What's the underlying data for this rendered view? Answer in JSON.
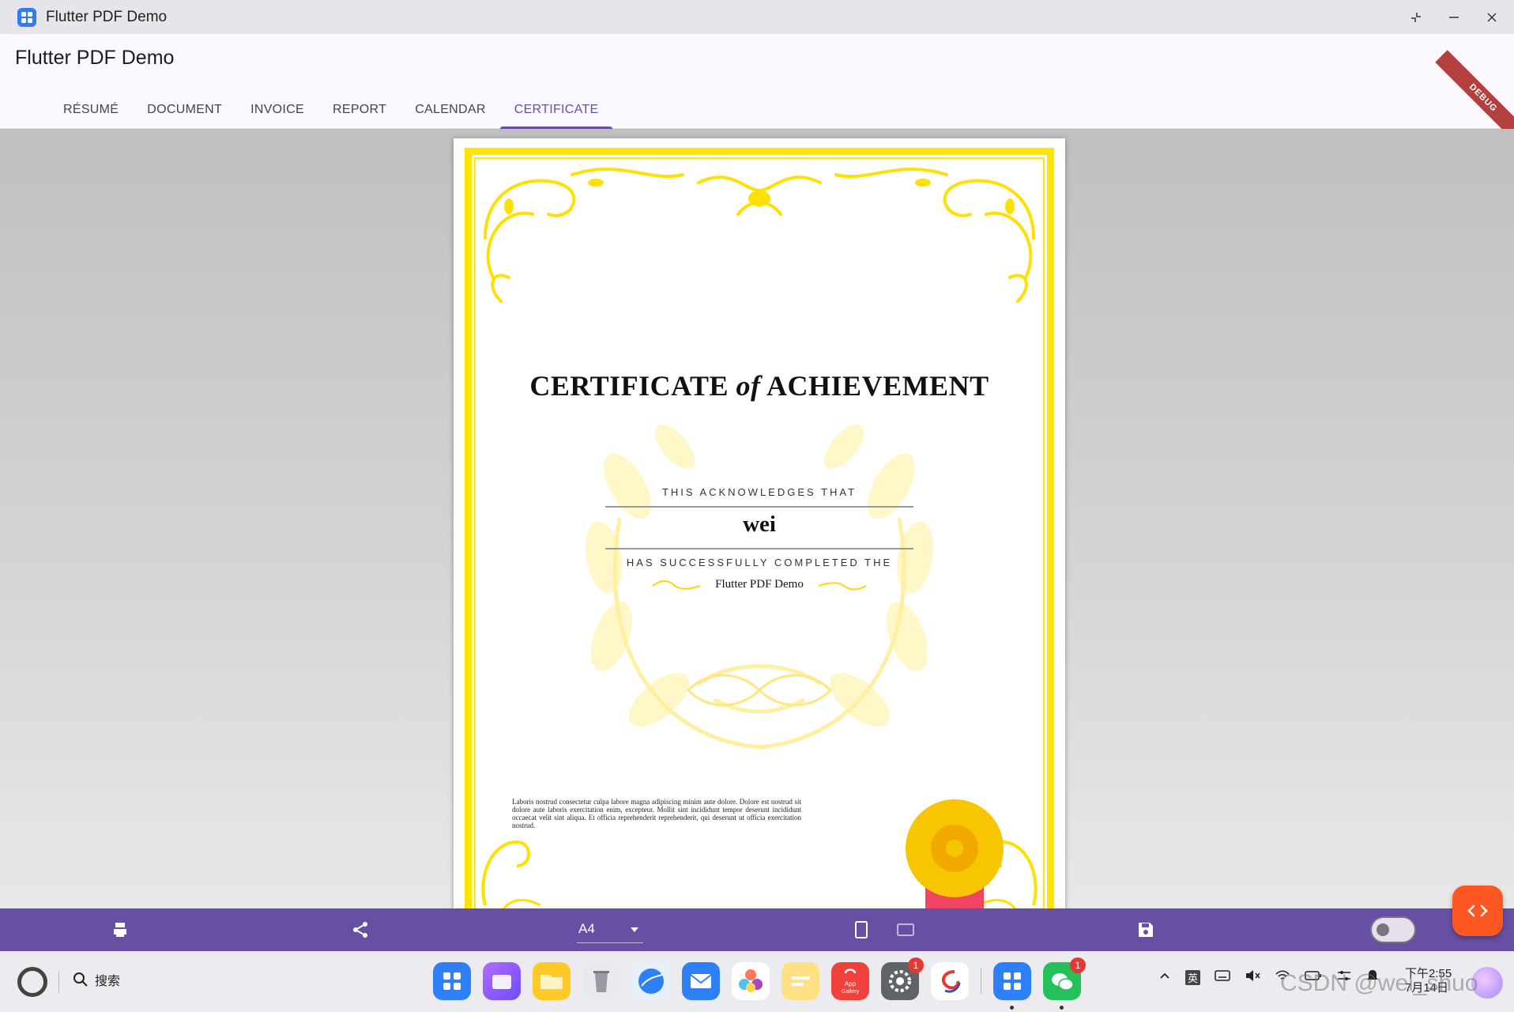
{
  "window": {
    "title": "Flutter PDF Demo"
  },
  "appbar": {
    "title": "Flutter PDF Demo",
    "debug_label": "DEBUG",
    "tabs": [
      {
        "label": "RÉSUMÉ",
        "active": false
      },
      {
        "label": "DOCUMENT",
        "active": false
      },
      {
        "label": "INVOICE",
        "active": false
      },
      {
        "label": "REPORT",
        "active": false
      },
      {
        "label": "CALENDAR",
        "active": false
      },
      {
        "label": "CERTIFICATE",
        "active": true
      }
    ],
    "accent_color": "#6750a4"
  },
  "certificate": {
    "heading_pre": "CERTIFICATE ",
    "heading_of": "of",
    "heading_post": " ACHIEVEMENT",
    "acknowledges": "THIS ACKNOWLEDGES THAT",
    "recipient": "wei",
    "completed": "HAS SUCCESSFULLY COMPLETED THE",
    "course": "Flutter PDF Demo",
    "body_text": "Laboris nostrud consectetur culpa labore magna adipiscing minim aute dolore. Dolore est nostrud sit dolore aute laboris exercitation enim, excepteur. Mollit sint incididunt tempor deserunt incididunt occaecat velit sint aliqua. Et officia reprehenderit reprehenderit, qui deserunt ut officia exercitation nostrud.",
    "border_color": "#ffe500",
    "seal_color": "#f7c600",
    "ribbon_color": "#ef4560"
  },
  "toolbar": {
    "page_format": "A4",
    "icons": [
      "print-icon",
      "share-icon",
      "portrait-icon",
      "landscape-icon",
      "save-icon"
    ],
    "fab_icon": "code-icon",
    "fab_color": "#ff5722"
  },
  "taskbar": {
    "search_label": "搜索",
    "dock_apps": [
      {
        "name": "launcher",
        "badge": ""
      },
      {
        "name": "multitask",
        "badge": ""
      },
      {
        "name": "files",
        "badge": ""
      },
      {
        "name": "trash",
        "badge": ""
      },
      {
        "name": "browser",
        "badge": ""
      },
      {
        "name": "mail",
        "badge": ""
      },
      {
        "name": "photos",
        "badge": ""
      },
      {
        "name": "notes",
        "badge": ""
      },
      {
        "name": "app-gallery",
        "badge": "",
        "label": "App Gallery"
      },
      {
        "name": "settings",
        "badge": "1"
      },
      {
        "name": "code-editor",
        "badge": ""
      },
      {
        "name": "flutter-pdf-demo",
        "badge": ""
      },
      {
        "name": "wechat",
        "badge": "1"
      }
    ],
    "ime_label": "英",
    "clock_time": "下午2:55",
    "clock_date": "7月14日",
    "watermark": "CSDN @wei_shuo"
  }
}
